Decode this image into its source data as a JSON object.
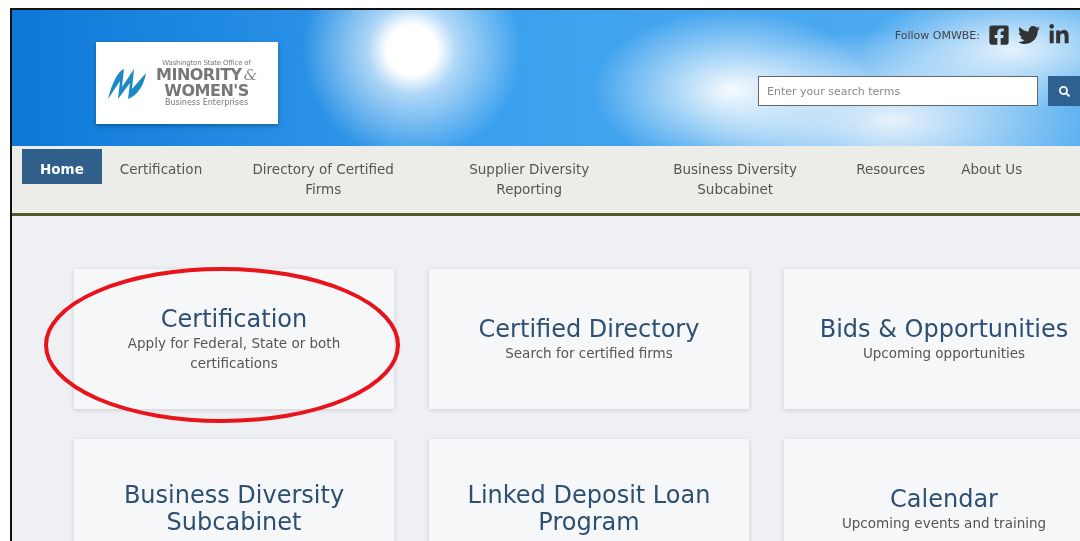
{
  "logo": {
    "line_1": "Washington State Office of",
    "line_2": "MINORITY",
    "ampersand": "&",
    "line_3": "WOMEN'S",
    "line_4": "Business Enterprises"
  },
  "social": {
    "label": "Follow OMWBE:"
  },
  "search": {
    "placeholder": "Enter your search terms"
  },
  "nav": [
    {
      "label": "Home",
      "selected": true
    },
    {
      "label": "Certification",
      "selected": false
    },
    {
      "label": "Directory of Certified Firms",
      "selected": false
    },
    {
      "label": "Supplier Diversity Reporting",
      "selected": false
    },
    {
      "label": "Business Diversity Subcabinet",
      "selected": false
    },
    {
      "label": "Resources",
      "selected": false
    },
    {
      "label": "About Us",
      "selected": false
    }
  ],
  "tiles": [
    {
      "title": "Certification",
      "subtitle": "Apply for Federal, State or both certifications",
      "highlighted": true
    },
    {
      "title": "Certified Directory",
      "subtitle": "Search for certified firms",
      "highlighted": false
    },
    {
      "title": "Bids & Opportunities",
      "subtitle": "Upcoming opportunities",
      "highlighted": false
    },
    {
      "title": "Business Diversity Subcabinet",
      "highlighted": false
    },
    {
      "title": "Linked Deposit Loan Program",
      "highlighted": false
    },
    {
      "title": "Calendar",
      "subtitle": "Upcoming events and training",
      "highlighted": false
    }
  ]
}
